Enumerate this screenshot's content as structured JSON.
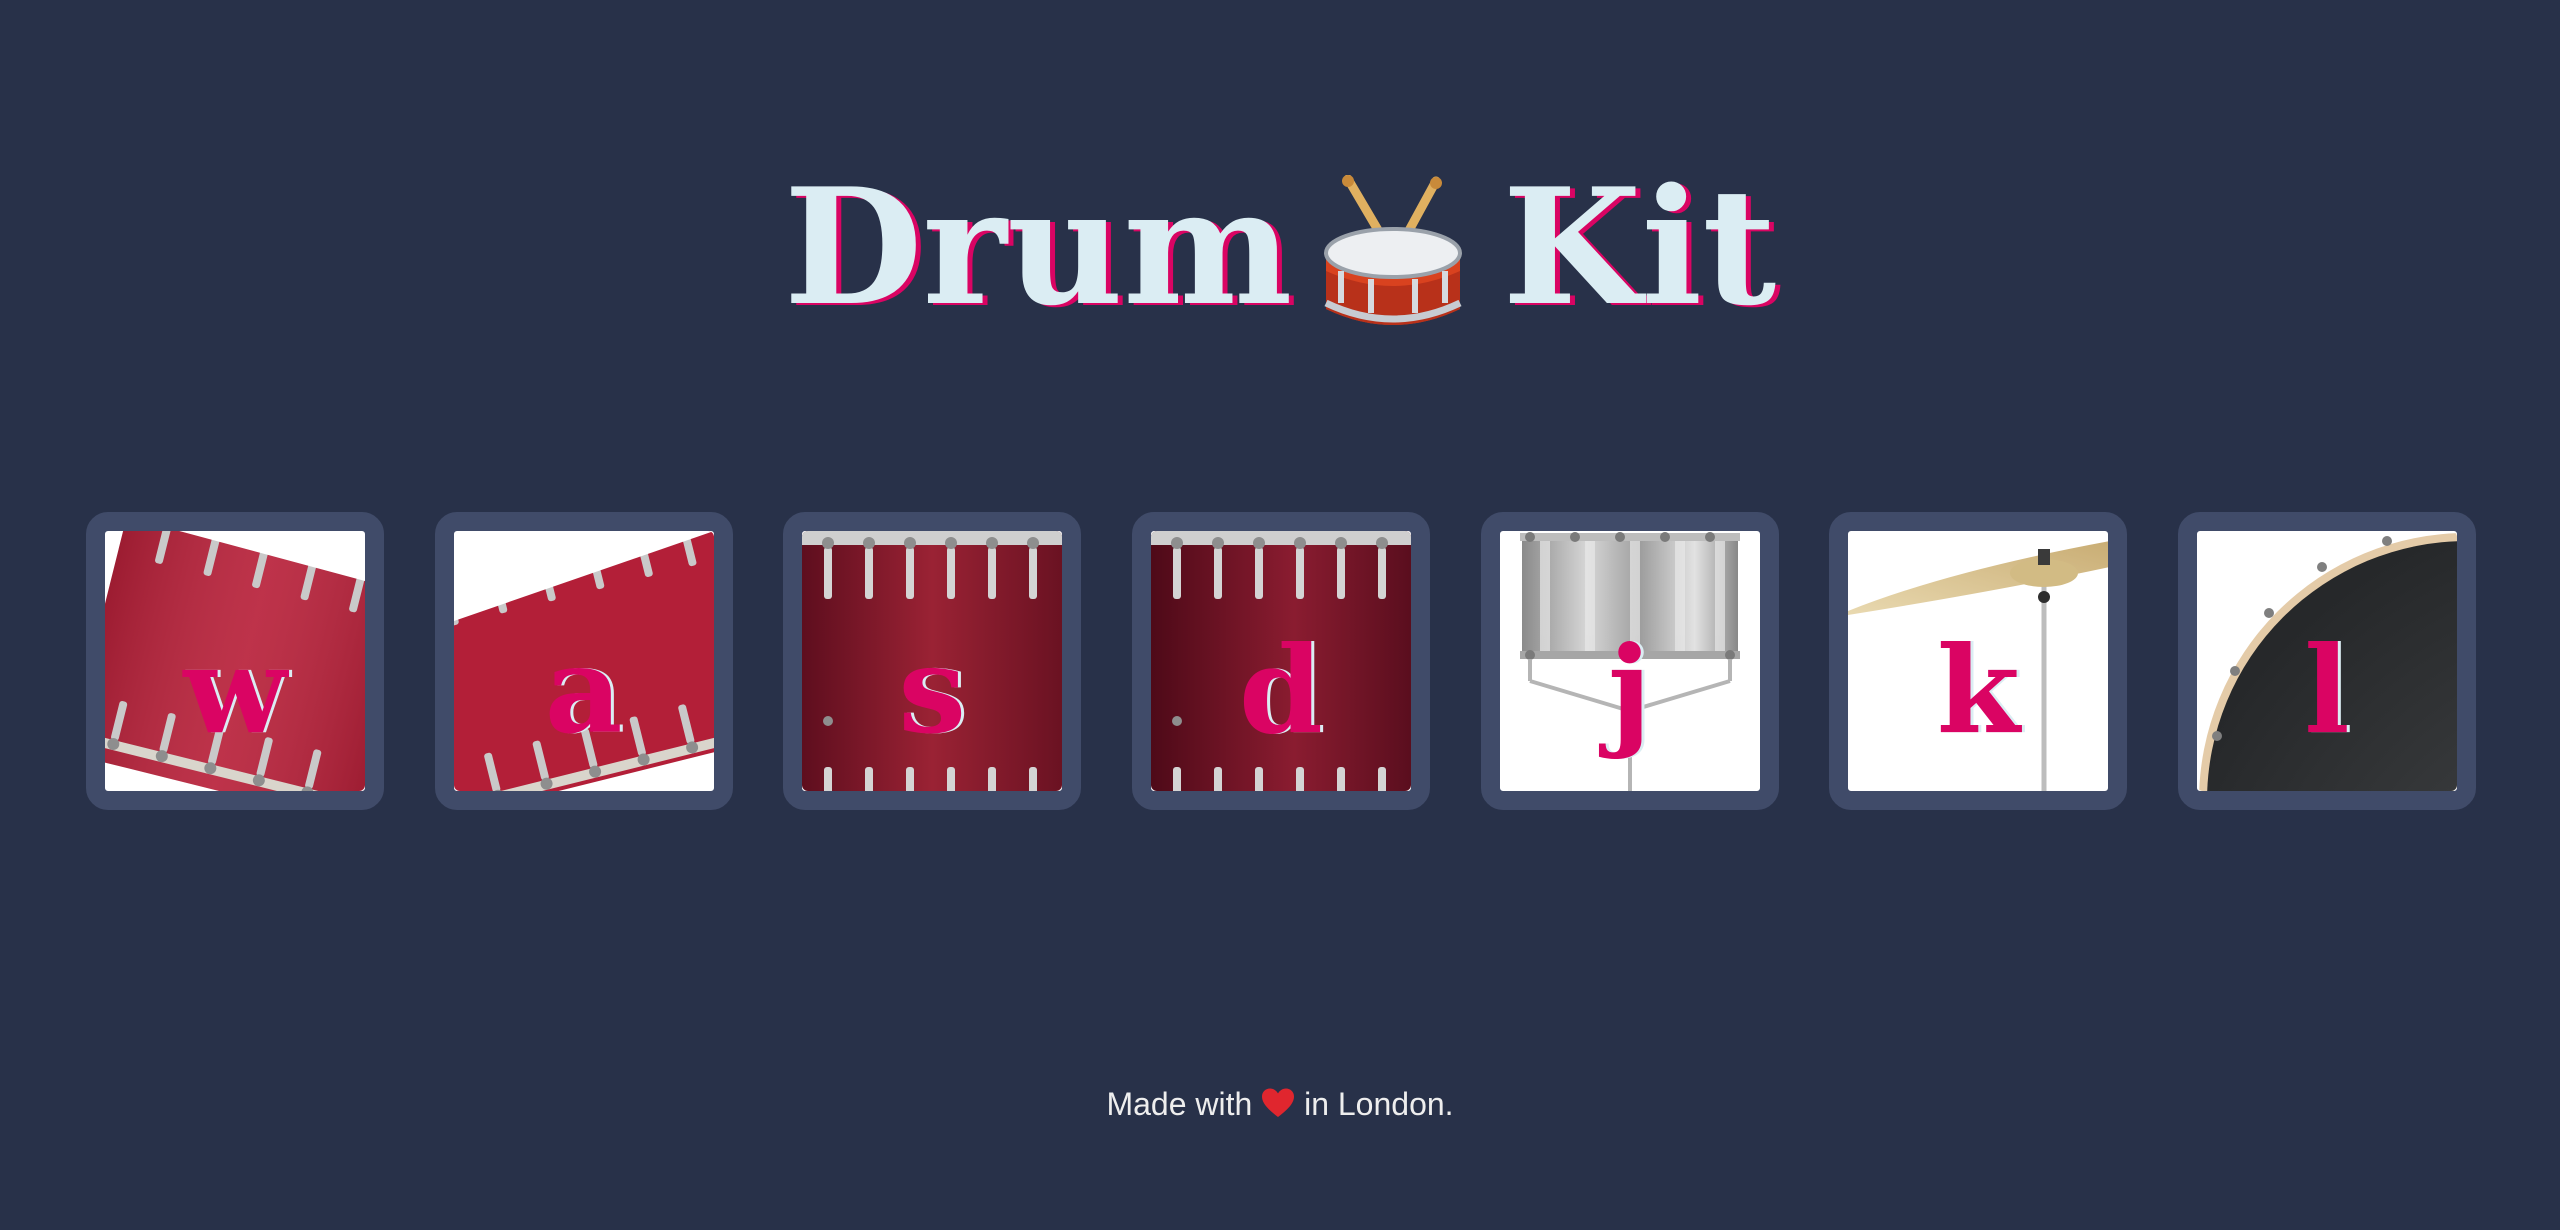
{
  "header": {
    "title_word_1": "Drum",
    "title_icon": "drum-icon",
    "title_word_2": "Kit"
  },
  "pads": [
    {
      "key": "w",
      "icon": "tom-1-drum-icon"
    },
    {
      "key": "a",
      "icon": "tom-2-drum-icon"
    },
    {
      "key": "s",
      "icon": "tom-3-drum-icon"
    },
    {
      "key": "d",
      "icon": "tom-4-drum-icon"
    },
    {
      "key": "j",
      "icon": "snare-drum-icon"
    },
    {
      "key": "k",
      "icon": "crash-cymbal-icon"
    },
    {
      "key": "l",
      "icon": "kick-drum-icon"
    }
  ],
  "footer": {
    "prefix": "Made with",
    "icon": "heart-icon",
    "suffix": "in London."
  },
  "colors": {
    "background": "#283149",
    "pad_border": "#404B69",
    "title_text": "#DBEDF3",
    "accent": "#DA0463"
  }
}
